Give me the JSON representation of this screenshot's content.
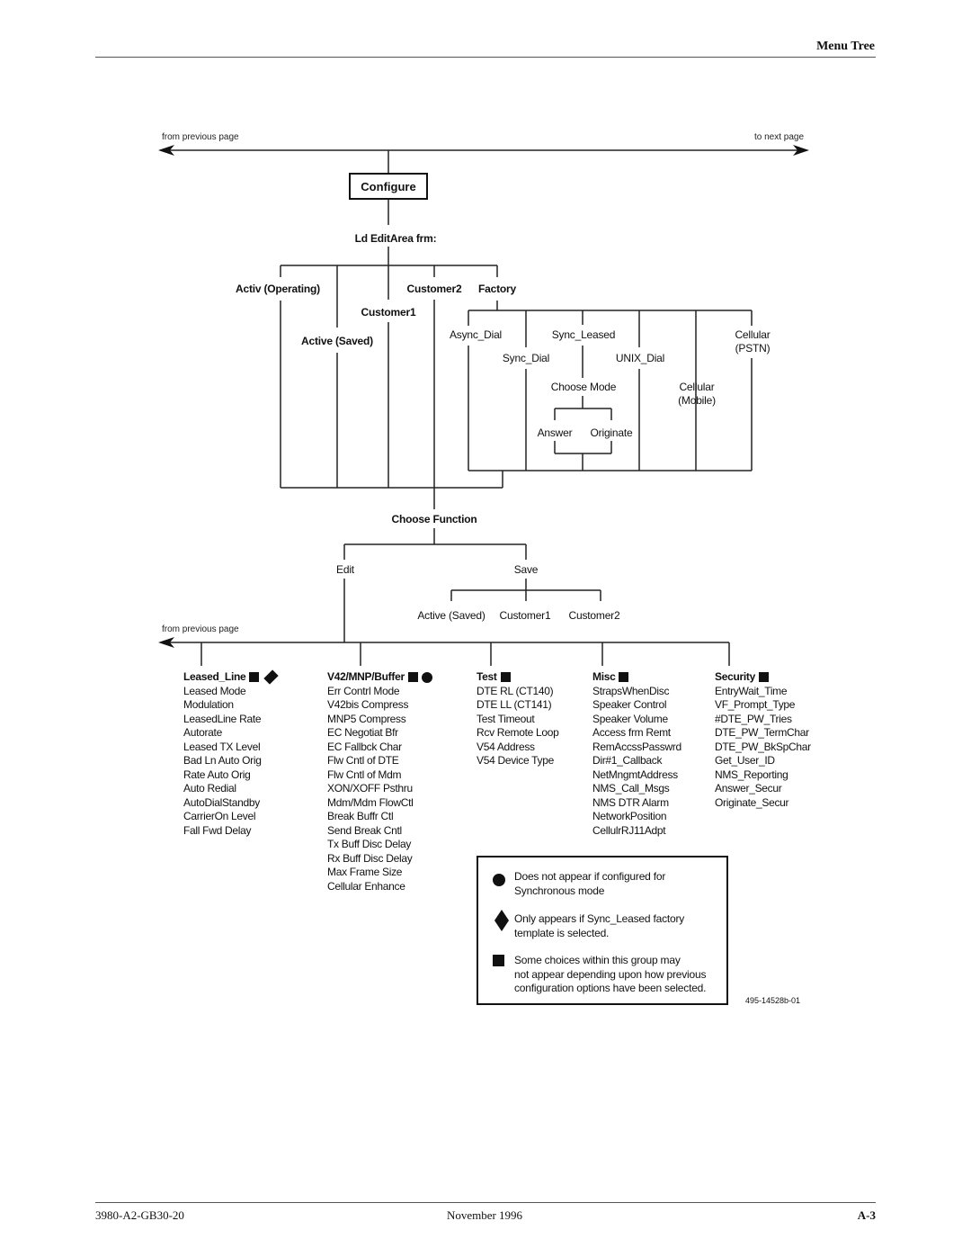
{
  "header": {
    "section_title": "Menu Tree"
  },
  "navigation": {
    "from_previous_top": "from previous page",
    "to_next": "to next page",
    "from_previous_bottom": "from previous page"
  },
  "tree": {
    "root": "Configure",
    "load_label": "Ld EditArea frm:",
    "load_options": [
      "Activ (Operating)",
      "Active (Saved)",
      "Customer1",
      "Customer2",
      "Factory"
    ],
    "factory_options": [
      "Async_Dial",
      "Sync_Dial",
      "Sync_Leased",
      "UNIX_Dial",
      "Cellular (Mobile)",
      "Cellular (PSTN)"
    ],
    "choose_mode": {
      "label": "Choose Mode",
      "options": [
        "Answer",
        "Originate"
      ]
    },
    "choose_function": {
      "label": "Choose Function",
      "options": [
        "Edit",
        "Save"
      ]
    },
    "save_targets": [
      "Active (Saved)",
      "Customer1",
      "Customer2"
    ]
  },
  "groups": [
    {
      "title": "Leased_Line",
      "markers": [
        "square",
        "diamond"
      ],
      "items": [
        "Leased Mode",
        "Modulation",
        "LeasedLine Rate",
        "Autorate",
        "Leased TX Level",
        "Bad Ln Auto Orig",
        "Rate Auto Orig",
        "Auto Redial",
        "AutoDialStandby",
        "CarrierOn Level",
        "Fall Fwd Delay"
      ]
    },
    {
      "title": "V42/MNP/Buffer",
      "markers": [
        "square",
        "circle"
      ],
      "items": [
        "Err Contrl Mode",
        "V42bis Compress",
        "MNP5 Compress",
        "EC Negotiat Bfr",
        "EC Fallbck Char",
        "Flw Cntl of DTE",
        "Flw Cntl of Mdm",
        "XON/XOFF Psthru",
        "Mdm/Mdm FlowCtl",
        "Break Buffr Ctl",
        "Send Break Cntl",
        "Tx Buff Disc Delay",
        "Rx Buff Disc Delay",
        "Max Frame Size",
        "Cellular Enhance"
      ]
    },
    {
      "title": "Test",
      "markers": [
        "square"
      ],
      "items": [
        "DTE RL (CT140)",
        "DTE LL (CT141)",
        "Test Timeout",
        "Rcv Remote Loop",
        "V54 Address",
        "V54 Device Type"
      ]
    },
    {
      "title": "Misc",
      "markers": [
        "square"
      ],
      "items": [
        "StrapsWhenDisc",
        "Speaker Control",
        "Speaker Volume",
        "Access frm Remt",
        "RemAccssPasswrd",
        "Dir#1_Callback",
        "NetMngmtAddress",
        "NMS_Call_Msgs",
        "NMS DTR Alarm",
        "NetworkPosition",
        "CellulrRJ11Adpt"
      ]
    },
    {
      "title": "Security",
      "markers": [
        "square"
      ],
      "items": [
        "EntryWait_Time",
        "VF_Prompt_Type",
        "#DTE_PW_Tries",
        "DTE_PW_TermChar",
        "DTE_PW_BkSpChar",
        "Get_User_ID",
        "NMS_Reporting",
        "Answer_Secur",
        "Originate_Secur"
      ]
    }
  ],
  "legend": {
    "circle": [
      "Does not appear if configured for",
      "Synchronous mode"
    ],
    "diamond": [
      "Only appears if Sync_Leased factory",
      "template is selected."
    ],
    "square": [
      "Some choices within this group may",
      "not appear depending upon how previous",
      "configuration options have been selected."
    ]
  },
  "figure_id": "495-14528b-01",
  "footer": {
    "doc_number": "3980-A2-GB30-20",
    "date": "November 1996",
    "page": "A-3"
  }
}
